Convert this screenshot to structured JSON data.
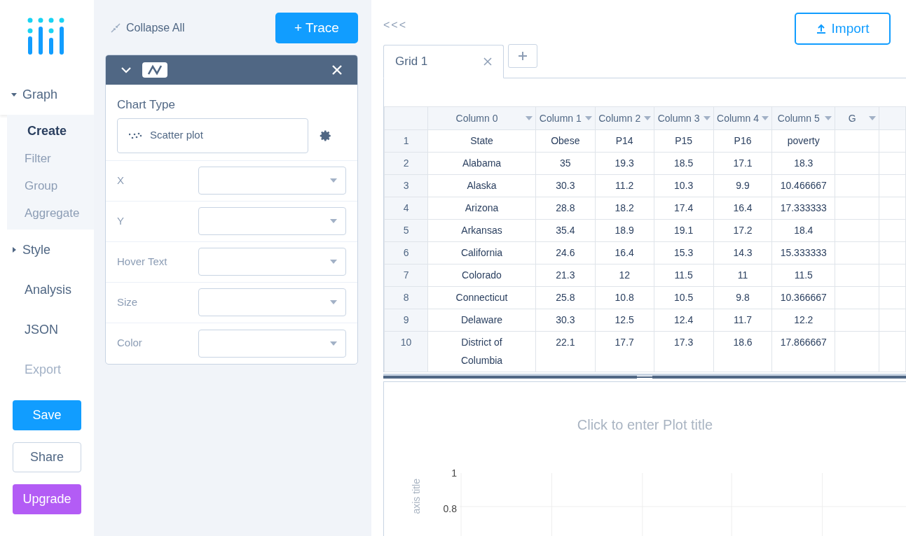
{
  "nav": [
    {
      "label": "Graph",
      "kind": "section",
      "expanded": true,
      "children": [
        {
          "label": "Create",
          "selected": true
        },
        {
          "label": "Filter",
          "selected": false
        },
        {
          "label": "Group",
          "selected": false
        },
        {
          "label": "Aggregate",
          "selected": false
        }
      ]
    },
    {
      "label": "Style",
      "kind": "section",
      "expanded": false
    },
    {
      "label": "Analysis",
      "kind": "item",
      "disabled": false
    },
    {
      "label": "JSON",
      "kind": "item",
      "disabled": false
    },
    {
      "label": "Export",
      "kind": "item",
      "disabled": true
    }
  ],
  "sidebar_buttons": [
    {
      "label": "Save",
      "kind": "primary"
    },
    {
      "label": "Share",
      "kind": "outline"
    },
    {
      "label": "Upgrade",
      "kind": "upgrade"
    }
  ],
  "panel": {
    "collapse_all": "Collapse All",
    "add_trace": "+ Trace",
    "trace": {
      "chart_type_label": "Chart Type",
      "chart_type": "Scatter plot",
      "fields": [
        {
          "label": "X"
        },
        {
          "label": "Y"
        },
        {
          "label": "Hover Text"
        },
        {
          "label": "Size"
        },
        {
          "label": "Color"
        }
      ]
    }
  },
  "collapse_arrows": "<<<",
  "import_button": "Import",
  "grid_tabs": [
    {
      "label": "Grid 1",
      "selected": true
    }
  ],
  "table": {
    "columns": [
      "",
      "Column 0",
      "Column 1",
      "Column 2",
      "Column 3",
      "Column 4",
      "Column 5",
      "G",
      ""
    ],
    "rows": [
      [
        "1",
        "State",
        "Obese",
        "P14",
        "P15",
        "P16",
        "poverty",
        "",
        ""
      ],
      [
        "2",
        "Alabama",
        "35",
        "19.3",
        "18.5",
        "17.1",
        "18.3",
        "",
        ""
      ],
      [
        "3",
        "Alaska",
        "30.3",
        "11.2",
        "10.3",
        "9.9",
        "10.466667",
        "",
        ""
      ],
      [
        "4",
        "Arizona",
        "28.8",
        "18.2",
        "17.4",
        "16.4",
        "17.333333",
        "",
        ""
      ],
      [
        "5",
        "Arkansas",
        "35.4",
        "18.9",
        "19.1",
        "17.2",
        "18.4",
        "",
        ""
      ],
      [
        "6",
        "California",
        "24.6",
        "16.4",
        "15.3",
        "14.3",
        "15.333333",
        "",
        ""
      ],
      [
        "7",
        "Colorado",
        "21.3",
        "12",
        "11.5",
        "11",
        "11.5",
        "",
        ""
      ],
      [
        "8",
        "Connecticut",
        "25.8",
        "10.8",
        "10.5",
        "9.8",
        "10.366667",
        "",
        ""
      ],
      [
        "9",
        "Delaware",
        "30.3",
        "12.5",
        "12.4",
        "11.7",
        "12.2",
        "",
        ""
      ],
      [
        "10",
        "District of Columbia",
        "22.1",
        "17.7",
        "17.3",
        "18.6",
        "17.866667",
        "",
        ""
      ]
    ]
  },
  "plot": {
    "title_placeholder": "Click to enter Plot title",
    "y_axis_title": "axis title",
    "y_ticks": [
      "1",
      "0.8"
    ]
  }
}
